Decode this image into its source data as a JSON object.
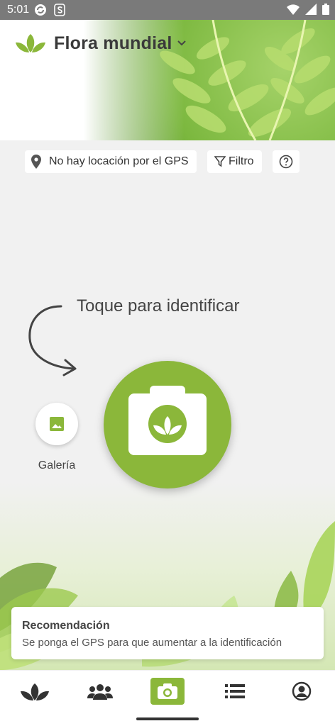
{
  "status_bar": {
    "time": "5:01"
  },
  "header": {
    "title": "Flora mundial"
  },
  "filters": {
    "gps_label": "No hay locación por el GPS",
    "filter_label": "Filtro"
  },
  "main": {
    "hint": "Toque para identificar",
    "gallery_label": "Galería"
  },
  "recommendation": {
    "title": "Recomendación",
    "text": "Se ponga el GPS para que aumentar a la identificación"
  },
  "bottom_nav": {
    "items": [
      "plants-icon",
      "community-icon",
      "camera-icon",
      "list-icon",
      "profile-icon"
    ]
  },
  "colors": {
    "accent": "#8bb73a",
    "background": "#f1f1f1",
    "status_bar": "#7a7a7a"
  }
}
